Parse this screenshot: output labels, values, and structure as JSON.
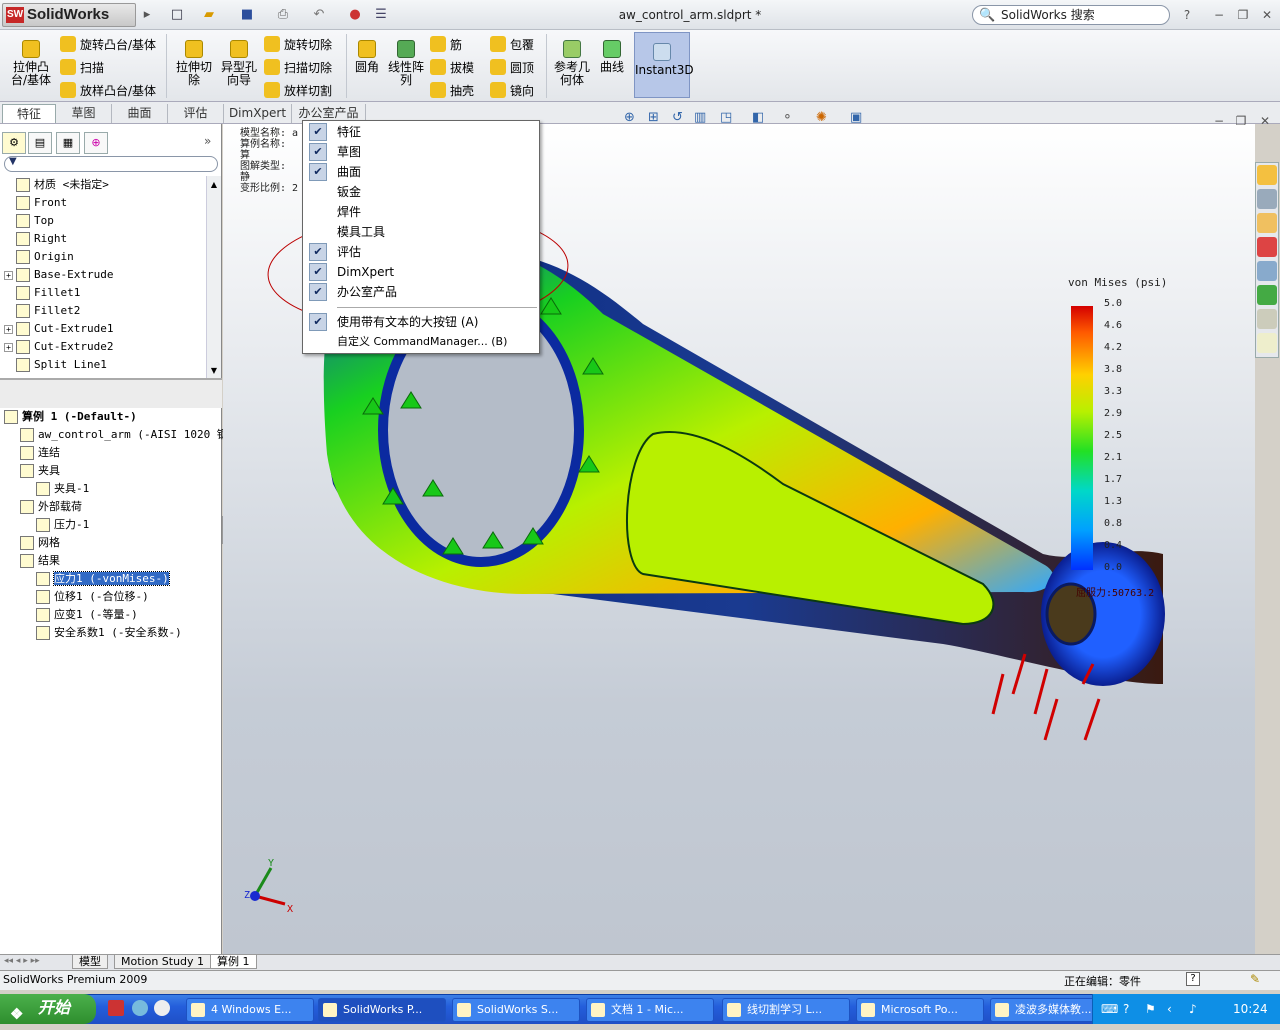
{
  "app": {
    "logo": "SolidWorks",
    "logo_badge": "SW",
    "doc_title": "aw_control_arm.sldprt *",
    "search_placeholder": "SolidWorks 搜索",
    "help": "?"
  },
  "ribbon": {
    "extrude": "拉伸凸\n台/基体",
    "revolve": "旋转凸台/基体",
    "sweep": "扫描",
    "loft": "放样凸台/基体",
    "extcut": "拉伸切\n除",
    "hole": "异型孔\n向导",
    "revcut": "旋转切除",
    "sweepcut": "扫描切除",
    "loftcut": "放样切割",
    "fillet": "圆角",
    "pattern": "线性阵\n列",
    "rib": "筋",
    "draft": "拔模",
    "shell": "抽壳",
    "wrap": "包覆",
    "dome": "圆顶",
    "mirror": "镜向",
    "refgeom": "参考几\n何体",
    "curves": "曲线",
    "instant3d": "Instant3D"
  },
  "tabs": [
    "特征",
    "草图",
    "曲面",
    "评估",
    "DimXpert",
    "办公室产品"
  ],
  "tree": {
    "top_items": [
      {
        "label": "材质 <未指定>",
        "exp": false
      },
      {
        "label": "Front",
        "exp": false
      },
      {
        "label": "Top",
        "exp": false
      },
      {
        "label": "Right",
        "exp": false
      },
      {
        "label": "Origin",
        "exp": false
      },
      {
        "label": "Base-Extrude",
        "exp": true
      },
      {
        "label": "Fillet1",
        "exp": false
      },
      {
        "label": "Fillet2",
        "exp": false
      },
      {
        "label": "Cut-Extrude1",
        "exp": true
      },
      {
        "label": "Cut-Extrude2",
        "exp": true
      },
      {
        "label": "Split Line1",
        "exp": false
      }
    ],
    "study": "算例 1 (-Default-)",
    "study_items": [
      {
        "label": "aw_control_arm (-AISI 1020 钢,",
        "indent": 1
      },
      {
        "label": "连结",
        "indent": 1
      },
      {
        "label": "夹具",
        "indent": 1
      },
      {
        "label": "夹具-1",
        "indent": 2
      },
      {
        "label": "外部载荷",
        "indent": 1
      },
      {
        "label": "压力-1",
        "indent": 2
      },
      {
        "label": "网格",
        "indent": 1
      },
      {
        "label": "结果",
        "indent": 1
      },
      {
        "label": "应力1 (-vonMises-)",
        "indent": 2
      },
      {
        "label": "位移1 (-合位移-)",
        "indent": 2
      },
      {
        "label": "应变1 (-等量-)",
        "indent": 2
      },
      {
        "label": "安全系数1 (-安全系数-)",
        "indent": 2
      }
    ]
  },
  "model_info": [
    "模型名称: a",
    "算例名称: 算",
    "图解类型: 静",
    "变形比例: 2"
  ],
  "legend": {
    "title": "von Mises (psi)",
    "ticks": [
      "5.0",
      "4.6",
      "4.2",
      "3.8",
      "3.3",
      "2.9",
      "2.5",
      "2.1",
      "1.7",
      "1.3",
      "0.8",
      "0.4",
      "0.0"
    ],
    "yield_label": "屈服力:50763.2"
  },
  "menu": {
    "items": [
      {
        "label": "特征",
        "checked": true
      },
      {
        "label": "草图",
        "checked": true
      },
      {
        "label": "曲面",
        "checked": true
      },
      {
        "label": "钣金",
        "checked": false
      },
      {
        "label": "焊件",
        "checked": false
      },
      {
        "label": "模具工具",
        "checked": false
      },
      {
        "label": "评估",
        "checked": true
      },
      {
        "label": "DimXpert",
        "checked": true
      },
      {
        "label": "办公室产品",
        "checked": true
      }
    ],
    "big_buttons": "使用带有文本的大按钮 (A)",
    "customize": "自定义 CommandManager... (B)"
  },
  "axes": {
    "x": "X",
    "y": "Y",
    "z": "Z"
  },
  "bottom_tabs": [
    "模型",
    "Motion Study 1",
    "算例 1"
  ],
  "status": {
    "left": "SolidWorks Premium 2009",
    "right": "正在编辑：零件",
    "help": "?"
  },
  "taskbar": {
    "start": "开始",
    "items": [
      "4 Windows E...",
      "SolidWorks P...",
      "SolidWorks S...",
      "文档 1 - Mic...",
      "线切割学习 L...",
      "Microsoft Po...",
      "凌波多媒体教..."
    ],
    "clock": "10:24"
  }
}
